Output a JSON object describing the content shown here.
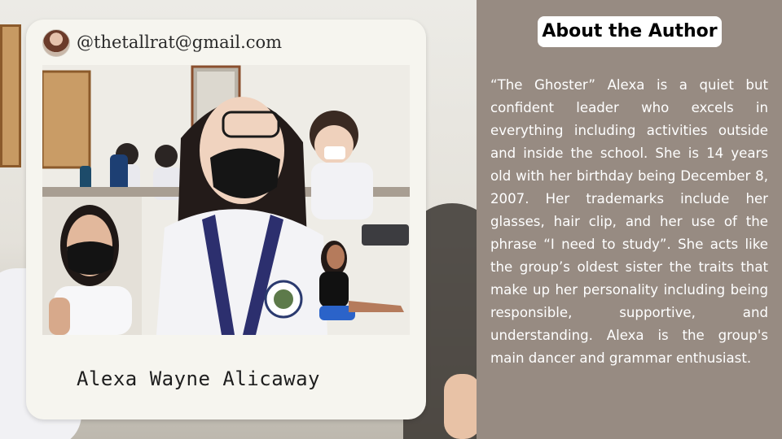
{
  "card": {
    "handle": "@thetallrat@gmail.com",
    "name": "Alexa Wayne Alicaway"
  },
  "about": {
    "title": "About the Author",
    "body": "“The Ghoster” Alexa is a quiet but confident leader who excels in everything including activities outside and inside the school. She is 14 years old with her birthday being December 8, 2007. Her trademarks include her glasses, hair clip, and her use of the phrase “I need to study”. She acts like the group’s oldest sister the traits that make up her personality including being responsible, supportive, and understanding. Alexa is the group's main dancer and grammar enthusiast."
  },
  "colors": {
    "panel_bg": "#978b82",
    "card_bg": "#f6f5ef",
    "title_bg": "#ffffff",
    "body_text": "#ffffff"
  }
}
